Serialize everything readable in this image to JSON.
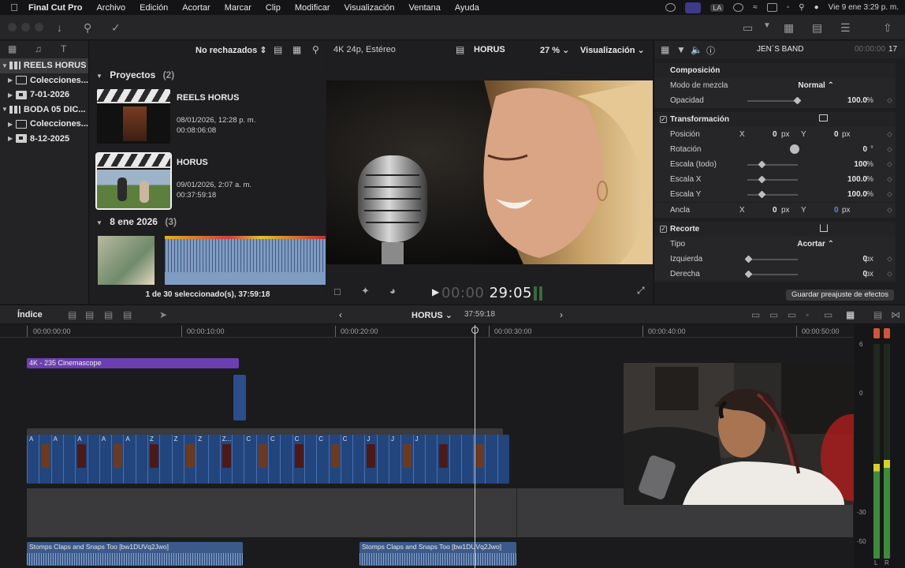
{
  "menubar": {
    "app_name": "Final Cut Pro",
    "items": [
      "Archivo",
      "Edición",
      "Acortar",
      "Marcar",
      "Clip",
      "Modificar",
      "Visualización",
      "Ventana",
      "Ayuda"
    ],
    "input_source": "LA",
    "datetime": "Vie 9 ene  3:29 p. m."
  },
  "libraries": {
    "items": [
      {
        "label": "REELS HORUS",
        "type": "library",
        "selected": true
      },
      {
        "label": "Colecciones...",
        "type": "collection"
      },
      {
        "label": "7-01-2026",
        "type": "event"
      },
      {
        "label": "BODA 05 DIC...",
        "type": "library"
      },
      {
        "label": "Colecciones...",
        "type": "collection"
      },
      {
        "label": "8-12-2025",
        "type": "event"
      }
    ]
  },
  "browser": {
    "filter": "No rechazados",
    "projects_section": {
      "title": "Proyectos",
      "count": "(2)"
    },
    "projects": [
      {
        "name": "REELS HORUS",
        "date": "08/01/2026, 12:28 p. m.",
        "duration": "00:08:06:08"
      },
      {
        "name": "HORUS",
        "date": "09/01/2026, 2:07 a. m.",
        "duration": "00:37:59:18"
      }
    ],
    "event_section": {
      "title": "8 ene 2026",
      "count": "(3)"
    },
    "status": "1 de 30 seleccionado(s), 37:59:18"
  },
  "viewer": {
    "format": "4K 24p, Estéreo",
    "project": "HORUS",
    "zoom": "27 %",
    "view_menu": "Visualización",
    "timecode_dim": "00:00",
    "timecode": "29:05"
  },
  "inspector": {
    "clip_name": "JEN´S BAND",
    "clip_time": "00:00:00",
    "clip_time_frames": "17",
    "rows": [
      {
        "kind": "section",
        "label": "Composición"
      },
      {
        "kind": "param",
        "label": "Modo de mezcla",
        "value": "Normal ⌃",
        "unit": ""
      },
      {
        "kind": "param",
        "label": "Opacidad",
        "value": "100.0",
        "unit": "%"
      },
      {
        "kind": "section",
        "label": "Transformación",
        "check": true
      },
      {
        "kind": "xy",
        "label": "Posición",
        "x": "0",
        "y": "0",
        "unit": "px"
      },
      {
        "kind": "param",
        "label": "Rotación",
        "value": "0",
        "unit": "°"
      },
      {
        "kind": "param",
        "label": "Escala (todo)",
        "value": "100",
        "unit": "%"
      },
      {
        "kind": "param",
        "label": "Escala X",
        "value": "100.0",
        "unit": "%"
      },
      {
        "kind": "param",
        "label": "Escala Y",
        "value": "100.0",
        "unit": "%"
      },
      {
        "kind": "xy",
        "label": "Ancla",
        "x": "0",
        "y": "0",
        "unit": "px"
      },
      {
        "kind": "section",
        "label": "Recorte",
        "check": true
      },
      {
        "kind": "param",
        "label": "Tipo",
        "value": "Acortar ⌃",
        "unit": ""
      },
      {
        "kind": "param",
        "label": "Izquierda",
        "value": "0",
        "unit": "px"
      },
      {
        "kind": "param",
        "label": "Derecha",
        "value": "0",
        "unit": "px"
      }
    ],
    "x_label": "X",
    "y_label": "Y",
    "save_button": "Guardar preajuste de efectos"
  },
  "timeline": {
    "index_label": "Índice",
    "project": "HORUS",
    "duration": "37:59:18",
    "ruler": [
      "00:00:00:00",
      "00:00:10:00",
      "00:00:20:00",
      "00:00:30:00",
      "00:00:40:00",
      "00:00:50:00"
    ],
    "format_clip": "4K - 235 Cinemascope",
    "audio_clips": [
      {
        "name": "Stomps Claps and Snaps Too [bw1DUVq2Jwo]"
      },
      {
        "name": "Stomps Claps and Snaps Too [bw1DUVq2Jwo]"
      }
    ],
    "story_labels": [
      "A",
      "A",
      "A",
      "A",
      "A",
      "Z",
      "Z",
      "Z",
      "Z...",
      "C",
      "C",
      "C",
      "C",
      "C",
      "J",
      "J",
      "J"
    ]
  },
  "meters": {
    "scale": [
      "6",
      "0",
      "-30",
      "-50"
    ],
    "channels": [
      "L",
      "R"
    ]
  },
  "colors": {
    "accent_purple": "#6c3fb0",
    "storyline_blue": "#23457e",
    "audio_blue": "#3b5a8a",
    "peak_red": "#d0553a"
  }
}
